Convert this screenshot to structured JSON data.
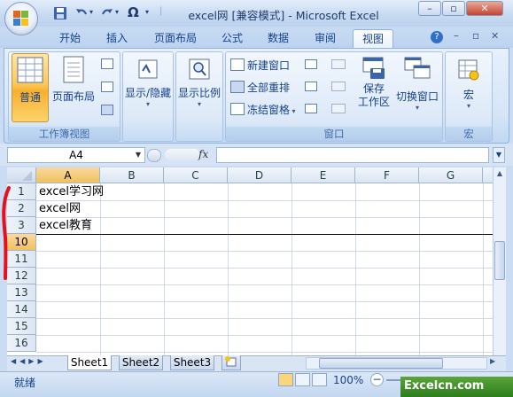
{
  "window": {
    "title": "excel网  [兼容模式] - Microsoft Excel",
    "controls": {
      "minimize": "–",
      "maximize": "▫",
      "close": "✕"
    }
  },
  "qat": {
    "save_icon": "save-icon",
    "undo_icon": "undo-icon",
    "redo_icon": "redo-icon",
    "omega": "Ω",
    "more": "▾"
  },
  "tabs": [
    "开始",
    "插入",
    "页面布局",
    "公式",
    "数据",
    "审阅",
    "视图"
  ],
  "active_tab": "视图",
  "tab_right": {
    "help": "?",
    "minimize": "–",
    "restore": "▫",
    "close": "✕"
  },
  "ribbon": {
    "workbook_views": {
      "label": "工作簿视图",
      "normal": "普通",
      "page_layout": "页面布局"
    },
    "show_hide": {
      "label": "显示/隐藏"
    },
    "zoom": {
      "label": "显示比例"
    },
    "window": {
      "label": "窗口",
      "new_window": "新建窗口",
      "arrange_all": "全部重排",
      "freeze_panes": "冻结窗格",
      "save_workspace": "保存\n工作区",
      "save_workspace_l1": "保存",
      "save_workspace_l2": "工作区",
      "switch_windows": "切换窗口"
    },
    "macros": {
      "label": "宏",
      "button": "宏"
    }
  },
  "formula_bar": {
    "name_box": "A4",
    "fx": "fx",
    "formula": ""
  },
  "grid": {
    "columns": [
      "A",
      "B",
      "C",
      "D",
      "E",
      "F",
      "G"
    ],
    "rows": [
      "1",
      "2",
      "3",
      "10",
      "11",
      "12",
      "13",
      "14",
      "15",
      "16"
    ],
    "cells": {
      "A1": "excel学习网",
      "A2": "excel网",
      "A3": "excel教育"
    },
    "selected_cell": "A4"
  },
  "sheets": [
    "Sheet1",
    "Sheet2",
    "Sheet3"
  ],
  "active_sheet": "Sheet1",
  "status": {
    "text": "就绪",
    "zoom": "100%",
    "zoom_minus": "−"
  },
  "watermark": "Excelcn.com",
  "colors": {
    "accent": "#15428b",
    "active_button": "#fbc85a",
    "annotation": "#e8101a"
  }
}
